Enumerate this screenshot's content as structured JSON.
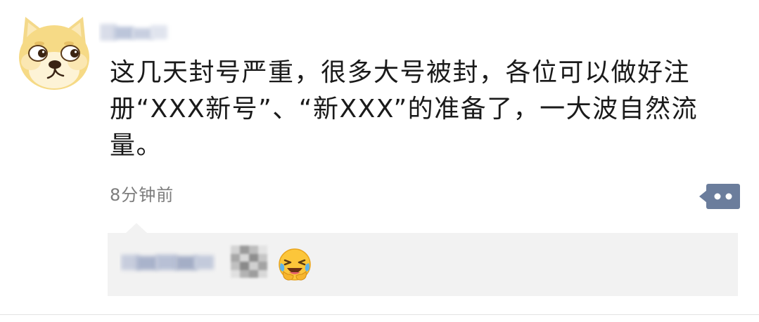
{
  "post": {
    "text": "这几天封号严重，很多大号被封，各位可以做好注册“XXX新号”、“新XXX”的准备了，一大波自然流量。",
    "timestamp": "8分钟前"
  },
  "icons": {
    "avatar": "doge-avatar",
    "more": "more-dots-icon",
    "comment_emoji": "laughing-crying-emoji-icon"
  },
  "colors": {
    "text": "#1a1a1a",
    "timestamp": "#7d7d7d",
    "comment_bg": "#f2f2f2",
    "more_button": "#6b7d9c"
  }
}
